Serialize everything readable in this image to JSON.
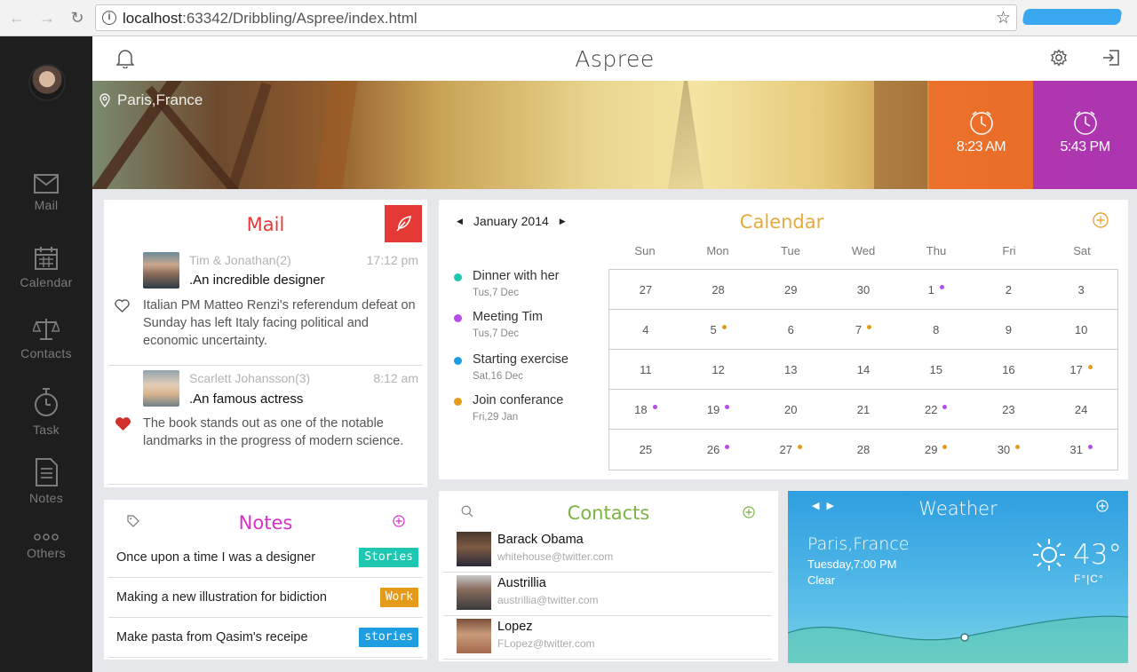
{
  "browser": {
    "url_host": "localhost",
    "url_rest": ":63342/Dribbling/Aspree/index.html"
  },
  "sidebar": {
    "items": [
      {
        "label": "Mail",
        "icon": "mail-icon"
      },
      {
        "label": "Calendar",
        "icon": "calendar-icon"
      },
      {
        "label": "Contacts",
        "icon": "scales-icon"
      },
      {
        "label": "Task",
        "icon": "stopwatch-icon"
      },
      {
        "label": "Notes",
        "icon": "document-icon"
      },
      {
        "label": "Others",
        "icon": "more-icon"
      }
    ]
  },
  "header": {
    "title": "Aspree"
  },
  "banner": {
    "location": "Paris,France",
    "clocks": [
      {
        "time": "8:23 AM",
        "color": "#f06e28"
      },
      {
        "time": "5:43 PM",
        "color": "#b032be"
      }
    ]
  },
  "mail": {
    "title": "Mail",
    "items": [
      {
        "from": "Tim & Jonathan(2)",
        "time": "17:12 pm",
        "subject": ".An incredible designer",
        "body": "Italian PM Matteo Renzi's referendum defeat on Sunday has left Italy facing political and economic uncertainty.",
        "liked": false
      },
      {
        "from": "Scarlett Johansson(3)",
        "time": "8:12 am",
        "subject": ".An famous actress",
        "body": "The book stands out as one of the notable landmarks in the progress of modern science.",
        "liked": true
      }
    ]
  },
  "calendar": {
    "month": "January 2014",
    "title": "Calendar",
    "weekdays": [
      "Sun",
      "Mon",
      "Tue",
      "Wed",
      "Thu",
      "Fri",
      "Sat"
    ],
    "events": [
      {
        "name": "Dinner with her",
        "date": "Tus,7 Dec",
        "color": "#1ec8b0"
      },
      {
        "name": "Meeting Tim",
        "date": "Tus,7 Dec",
        "color": "#b54de8"
      },
      {
        "name": "Starting exercise",
        "date": "Sat,16 Dec",
        "color": "#1e9ee0"
      },
      {
        "name": "Join conferance",
        "date": "Fri,29 Jan",
        "color": "#e59a19"
      }
    ],
    "days": [
      {
        "d": "27"
      },
      {
        "d": "28"
      },
      {
        "d": "29"
      },
      {
        "d": "30"
      },
      {
        "d": "1",
        "dot": "#b54de8"
      },
      {
        "d": "2"
      },
      {
        "d": "3"
      },
      {
        "d": "4"
      },
      {
        "d": "5",
        "dot": "#e59a19"
      },
      {
        "d": "6"
      },
      {
        "d": "7",
        "dot": "#e59a19"
      },
      {
        "d": "8"
      },
      {
        "d": "9"
      },
      {
        "d": "10"
      },
      {
        "d": "11"
      },
      {
        "d": "12"
      },
      {
        "d": "13"
      },
      {
        "d": "14"
      },
      {
        "d": "15"
      },
      {
        "d": "16"
      },
      {
        "d": "17",
        "dot": "#e59a19"
      },
      {
        "d": "18",
        "dot": "#b54de8"
      },
      {
        "d": "19",
        "dot": "#b54de8"
      },
      {
        "d": "20"
      },
      {
        "d": "21"
      },
      {
        "d": "22",
        "dot": "#b54de8"
      },
      {
        "d": "23"
      },
      {
        "d": "24"
      },
      {
        "d": "25"
      },
      {
        "d": "26",
        "dot": "#b54de8"
      },
      {
        "d": "27",
        "dot": "#e59a19"
      },
      {
        "d": "28"
      },
      {
        "d": "29",
        "dot": "#e59a19"
      },
      {
        "d": "30",
        "dot": "#e59a19"
      },
      {
        "d": "31",
        "dot": "#b54de8"
      }
    ]
  },
  "notes": {
    "title": "Notes",
    "items": [
      {
        "text": "Once upon a time I was a designer",
        "tag": "Stories",
        "tag_color": "#1ec8b0"
      },
      {
        "text": "Making a new illustration for bidiction",
        "tag": "Work",
        "tag_color": "#e59a19"
      },
      {
        "text": "Make pasta from Qasim's receipe",
        "tag": "stories",
        "tag_color": "#1e9ee0"
      }
    ]
  },
  "contacts": {
    "title": "Contacts",
    "items": [
      {
        "name": "Barack Obama",
        "email": "whitehouse@twitter.com"
      },
      {
        "name": "Austrillia",
        "email": "austrillia@twitter.com"
      },
      {
        "name": "Lopez",
        "email": "FLopez@twitter.com"
      }
    ]
  },
  "weather": {
    "title": "Weather",
    "city": "Paris,France",
    "time": "Tuesday,7:00 PM",
    "condition": "Clear",
    "temp": "43°",
    "units": "F°|C°"
  }
}
